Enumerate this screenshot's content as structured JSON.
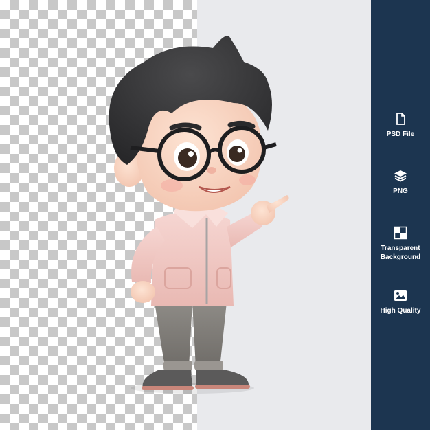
{
  "colors": {
    "sidebar_bg": "#1c3550",
    "panel_bg": "#e9eaed",
    "checker_dark": "#c8c8c8",
    "icon_color": "#ffffff"
  },
  "features": [
    {
      "icon": "file-icon",
      "label": "PSD File"
    },
    {
      "icon": "layers-icon",
      "label": "PNG"
    },
    {
      "icon": "transparency-grid-icon",
      "label": "Transparent Background"
    },
    {
      "icon": "image-icon",
      "label": "High Quality"
    }
  ]
}
